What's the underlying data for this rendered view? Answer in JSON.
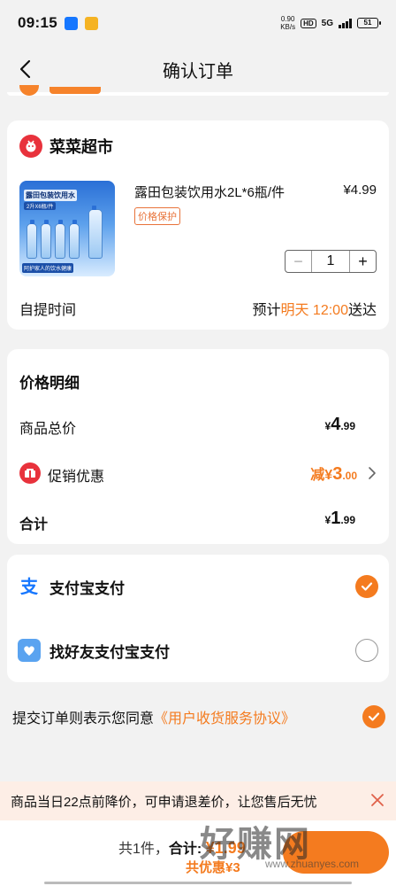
{
  "status_bar": {
    "time": "09:15",
    "net_speed_value": "0.90",
    "net_speed_unit": "KB/s",
    "hd": "HD",
    "network": "5G",
    "battery": "51"
  },
  "header": {
    "title": "确认订单"
  },
  "store": {
    "name": "菜菜超市",
    "product": {
      "image_label": "露田包装饮用水",
      "image_sub": "2升X6瓶/件",
      "image_foot": "阿护家人的饮水健康",
      "title": "露田包装饮用水2L*6瓶/件",
      "price": "¥4.99",
      "tag": "价格保护",
      "quantity": "1"
    },
    "pickup_label": "自提时间",
    "pickup_prefix": "预计",
    "pickup_time": "明天 12:00",
    "pickup_suffix": "送达"
  },
  "price_detail": {
    "title": "价格明细",
    "goods_total_label": "商品总价",
    "goods_total_symbol": "¥",
    "goods_total_int": "4",
    "goods_total_dec": ".99",
    "promo_label": "促销优惠",
    "promo_prefix": "减¥",
    "promo_int": "3",
    "promo_dec": ".00",
    "sum_label": "合计",
    "sum_symbol": "¥",
    "sum_int": "1",
    "sum_dec": ".99"
  },
  "payment": {
    "options": [
      {
        "label": "支付宝支付",
        "selected": true
      },
      {
        "label": "找好友支付宝支付",
        "selected": false
      }
    ]
  },
  "agreement": {
    "text": "提交订单则表示您同意",
    "link": "《用户收货服务协议》"
  },
  "notice": {
    "text": "商品当日22点前降价，可申请退差价，让您售后无忧"
  },
  "bottom": {
    "count_text": "共1件，",
    "total_label": "合计: ",
    "total_amount": "¥1.99",
    "saving_text": "共优惠¥3"
  },
  "watermark": {
    "text": "好赚网",
    "url": "www.zhuanyes.com"
  },
  "colors": {
    "accent": "#f47b1f",
    "brand_red": "#e8323c",
    "alipay_blue": "#1677ff"
  }
}
